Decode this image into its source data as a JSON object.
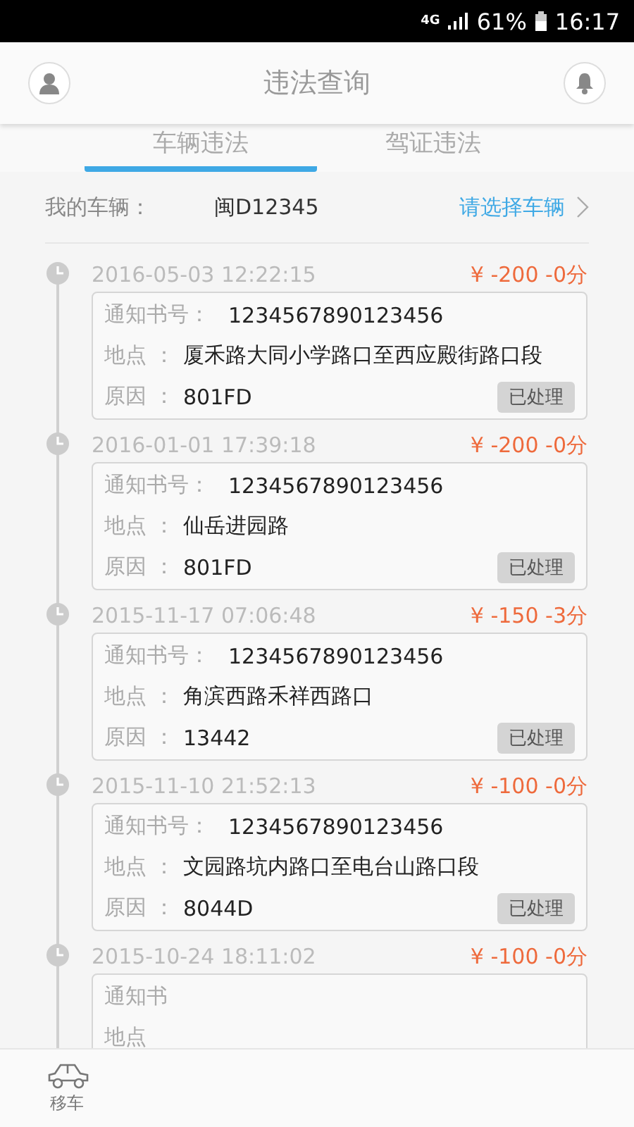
{
  "status_bar": {
    "network": "4G",
    "battery": "61%",
    "time": "16:17"
  },
  "header": {
    "title": "违法查询"
  },
  "tabs": [
    {
      "label": "车辆违法",
      "selected": true
    },
    {
      "label": "驾证违法",
      "selected": false
    }
  ],
  "vehicle": {
    "label": "我的车辆：",
    "plate": "闽D12345",
    "action": "请选择车辆"
  },
  "records": [
    {
      "date": "2016-05-03 12:22:15",
      "penalty": "¥ -200 -0分",
      "notice_label": "通知书号：",
      "notice": "1234567890123456",
      "place_label": "地点 ：",
      "place": "厦禾路大同小学路口至西应殿街路口段",
      "reason_label": "原因 ：",
      "reason": "801FD",
      "status": "已处理"
    },
    {
      "date": "2016-01-01 17:39:18",
      "penalty": "¥ -200 -0分",
      "notice_label": "通知书号：",
      "notice": "1234567890123456",
      "place_label": "地点 ：",
      "place": "仙岳进园路",
      "reason_label": "原因 ：",
      "reason": "801FD",
      "status": "已处理"
    },
    {
      "date": "2015-11-17 07:06:48",
      "penalty": "¥ -150 -3分",
      "notice_label": "通知书号：",
      "notice": "1234567890123456",
      "place_label": "地点 ：",
      "place": "角滨西路禾祥西路口",
      "reason_label": "原因 ：",
      "reason": "13442",
      "status": "已处理"
    },
    {
      "date": "2015-11-10 21:52:13",
      "penalty": "¥ -100 -0分",
      "notice_label": "通知书号：",
      "notice": "1234567890123456",
      "place_label": "地点 ：",
      "place": "文园路坑内路口至电台山路口段",
      "reason_label": "原因 ：",
      "reason": "8044D",
      "status": "已处理"
    },
    {
      "date": "2015-10-24 18:11:02",
      "penalty": "¥ -100 -0分",
      "notice_label": "通知书",
      "place_label": "地点"
    }
  ],
  "bottom_nav": [
    {
      "label": "移车"
    }
  ]
}
